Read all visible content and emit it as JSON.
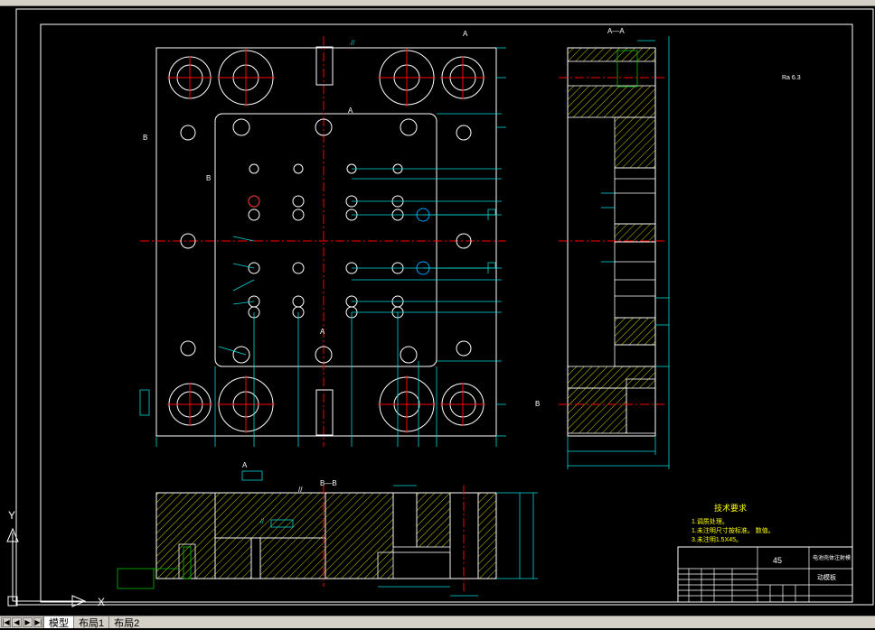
{
  "tabs": [
    "模型",
    "布局1",
    "布局2"
  ],
  "colors": {
    "outline": "#ffffff",
    "hatch": "#c8c800",
    "dim": "#00d8d8",
    "center": "#ff0000",
    "note": "#ffff00",
    "hole": "#ff4040",
    "green": "#00c000"
  },
  "section_labels": {
    "aa_side": "A—A",
    "bb_bottom": "B—B",
    "a_top": "A",
    "b_left": "B",
    "b_right": "B",
    "a_mid": "A",
    "a_bottom": "A",
    "b_mid": "B",
    "a_view": "A",
    "tol_1": "//",
    "tol_2": "//",
    "tol_3": "//"
  },
  "tech_requirements": {
    "title": "技术要求",
    "line1": "1.调质处理。",
    "line2": "1.未注明尺寸按标准。 数值。",
    "line3": "3.未注明1.5X45。"
  },
  "title_block": {
    "material": "45",
    "part_name": "电池壳体注射模",
    "drawing_name": "动模板"
  },
  "roughness": "Ra 6.3",
  "ucs": {
    "x": "X",
    "y": "Y"
  }
}
